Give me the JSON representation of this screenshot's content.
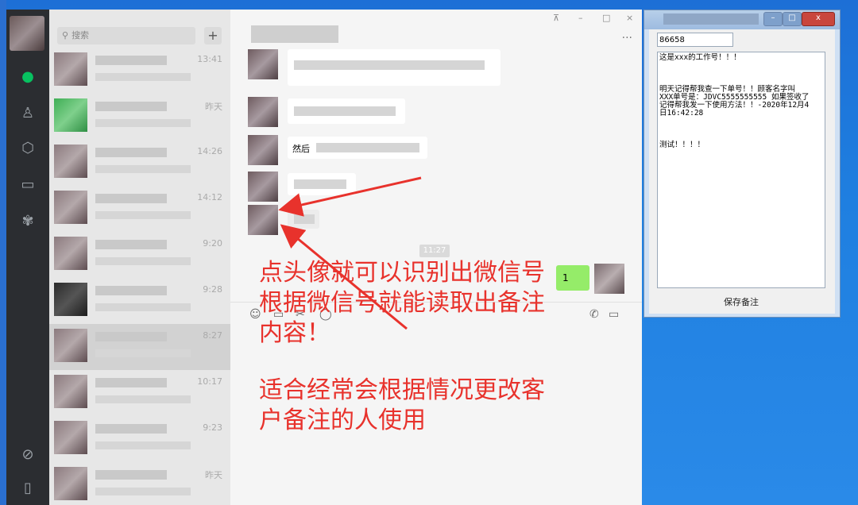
{
  "chat_list": {
    "search_placeholder": "搜索",
    "add_label": "+",
    "items": [
      {
        "time": "13:41"
      },
      {
        "time": "昨天"
      },
      {
        "time": "14:26"
      },
      {
        "time": "14:12"
      },
      {
        "time": "9:20"
      },
      {
        "time": "9:28"
      },
      {
        "time": "8:27"
      },
      {
        "time": "10:17"
      },
      {
        "time": "9:23"
      },
      {
        "time": "昨天"
      }
    ]
  },
  "chat": {
    "window_controls": [
      "⊼",
      "–",
      "□",
      "×"
    ],
    "more": "···",
    "partial_text": "然后",
    "time_chip": "11:27",
    "my_message": "1"
  },
  "annotation": {
    "line1": "点头像就可以识别出微信号",
    "line2": "根据微信号就能读取出备注",
    "line3": "内容！",
    "line4": "适合经常会根据情况更改客",
    "line5": "户备注的人使用",
    "color": "#e8322c"
  },
  "note_window": {
    "id_value": "86658",
    "lines": [
      "这是xxx的工作号！！！",
      "",
      "",
      "",
      "明天记得帮我查一下单号！！顾客名字叫",
      "XXX单号是：JDVC5555555555   如果签收了",
      "记得帮我发一下使用方法！！-2020年12月4",
      "日16:42:28",
      "",
      "",
      "",
      "测试！！！！"
    ],
    "save_label": "保存备注",
    "titlebar_buttons": [
      "–",
      "□",
      "x"
    ]
  },
  "colors": {
    "desktop": "#1f7fe0",
    "sidebar": "#2b2d31",
    "accent_green": "#07c160",
    "my_bubble": "#95ec69"
  }
}
